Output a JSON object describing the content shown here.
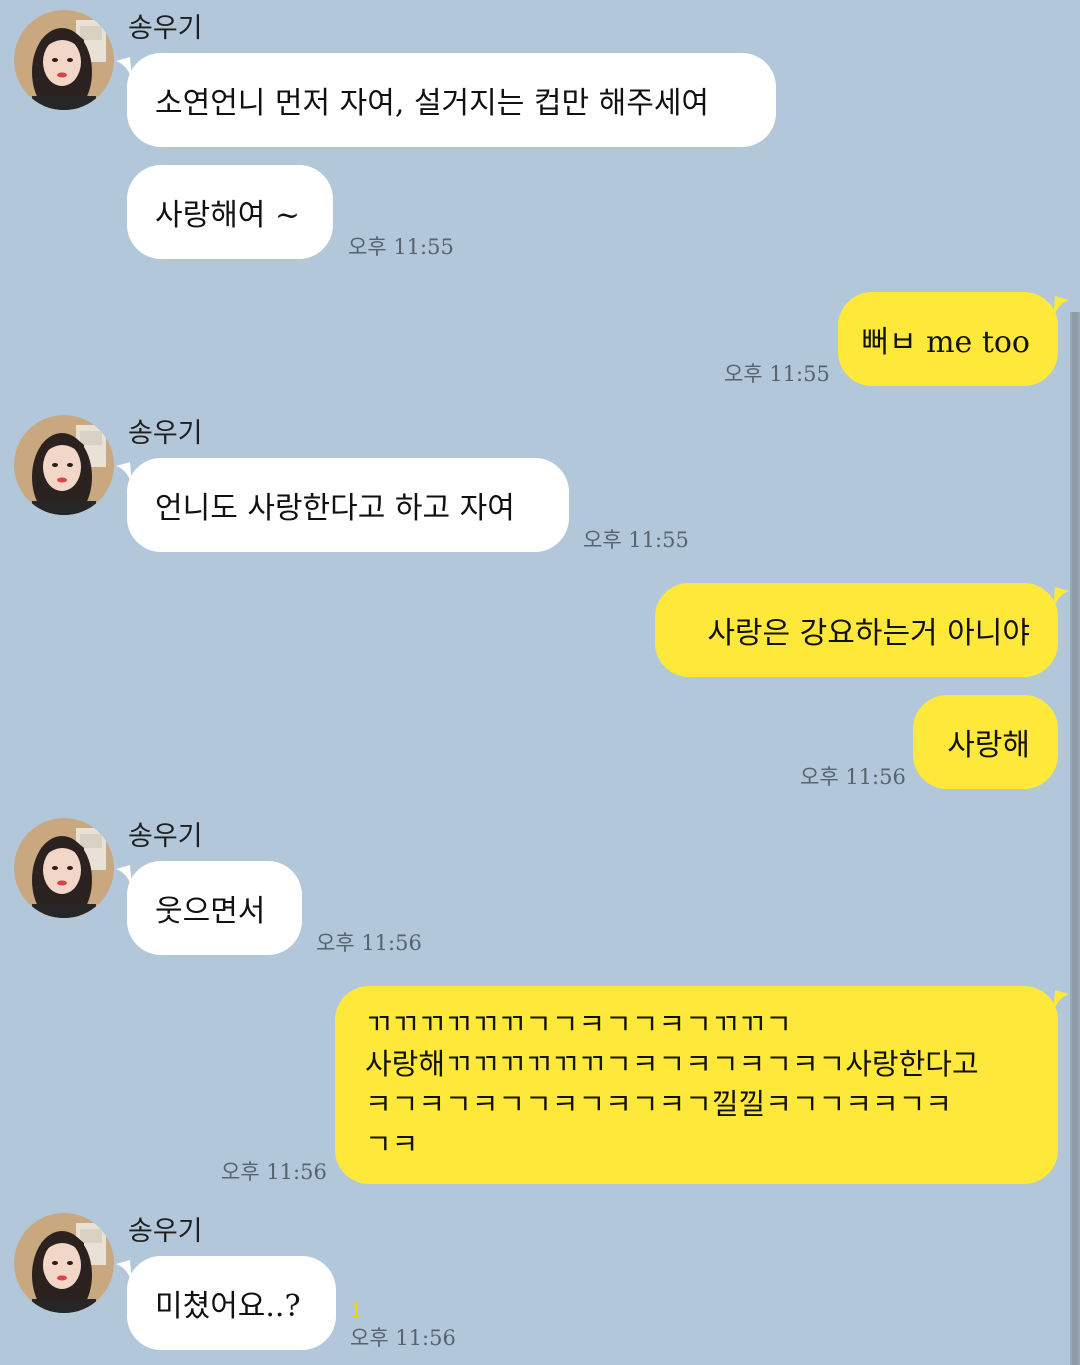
{
  "colors": {
    "background": "#b2c7da",
    "incoming_bubble": "#ffffff",
    "outgoing_bubble": "#fee93a",
    "unread_count": "#f2d200"
  },
  "contact": {
    "name": "송우기",
    "avatar_icon": "profile-photo"
  },
  "messages": {
    "m1": {
      "text": "소연언니 먼저 자여, 설거지는 컵만 해주세여"
    },
    "m2": {
      "text": "사랑해여 ~",
      "time": "오후 11:55"
    },
    "m3": {
      "text": "뻐ㅂ me too",
      "time": "오후 11:55"
    },
    "m4": {
      "text": "언니도 사랑한다고 하고 자여",
      "time": "오후 11:55"
    },
    "m5": {
      "text": "사랑은 강요하는거 아니야"
    },
    "m6": {
      "text": "사랑해",
      "time": "오후 11:56"
    },
    "m7": {
      "text": "웃으면서",
      "time": "오후 11:56"
    },
    "m8": {
      "lines": [
        "ㄲㄲㄲㄲㄲㄲㄱㄱㅋㄱㄱㅋㄱㄲㄲㄱ",
        "사랑해ㄲㄲㄲㄲㄲㄲㄱㅋㄱㅋㄱㅋㄱㅋㄱ사랑한다고",
        "ㅋㄱㅋㄱㅋㄱㄱㅋㄱㅋㄱㅋㄱ낄낄ㅋㄱㄱㅋㅋㄱㅋ",
        "ㄱㅋ"
      ],
      "time": "오후 11:56"
    },
    "m9": {
      "text": "미쳤어요..?",
      "time": "오후 11:56",
      "unread": "1"
    }
  }
}
